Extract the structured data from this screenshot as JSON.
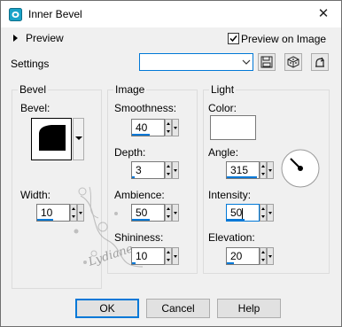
{
  "window": {
    "title": "Inner Bevel",
    "close_glyph": "✕"
  },
  "preview": {
    "label": "Preview",
    "preview_on_image_label": "Preview on Image",
    "preview_on_image_checked": true
  },
  "settings": {
    "label": "Settings",
    "value": ""
  },
  "bevel_group": {
    "title": "Bevel",
    "bevel_label": "Bevel:",
    "width_label": "Width:",
    "width_value": "10"
  },
  "image_group": {
    "title": "Image",
    "smoothness_label": "Smoothness:",
    "smoothness_value": "40",
    "depth_label": "Depth:",
    "depth_value": "3",
    "ambience_label": "Ambience:",
    "ambience_value": "50",
    "shininess_label": "Shininess:",
    "shininess_value": "10"
  },
  "light_group": {
    "title": "Light",
    "color_label": "Color:",
    "color_value": "#ffffff",
    "angle_label": "Angle:",
    "angle_value": "315",
    "intensity_label": "Intensity:",
    "intensity_value": "50",
    "elevation_label": "Elevation:",
    "elevation_value": "20"
  },
  "buttons": {
    "ok": "OK",
    "cancel": "Cancel",
    "help": "Help"
  },
  "watermark_text": "Lydiane",
  "colors": {
    "accent": "#0078d7",
    "title_icon": "#1aa3c8"
  },
  "icons": [
    "app-icon",
    "close-icon",
    "expand-arrow-icon",
    "checkbox-icon",
    "dropdown-arrow-icon",
    "save-preset-icon",
    "randomize-icon",
    "reset-icon",
    "angle-dial-icon"
  ]
}
